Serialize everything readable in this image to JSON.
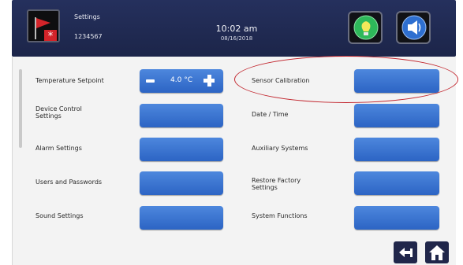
{
  "header": {
    "title": "Settings",
    "subtitle": "1234567",
    "time": "10:02 am",
    "date": "08/16/2018",
    "bg_color": "#1c2549",
    "icons": {
      "alarm": "alarm-flag-icon",
      "light": "lightbulb-icon",
      "sound": "speaker-icon"
    }
  },
  "menu": {
    "left": [
      {
        "label": "Temperature Setpoint"
      },
      {
        "label": "Device Control\nSettings"
      },
      {
        "label": "Alarm Settings"
      },
      {
        "label": "Users and Passwords"
      },
      {
        "label": "Sound Settings"
      }
    ],
    "right": [
      {
        "label": "Sensor Calibration"
      },
      {
        "label": "Date / Time"
      },
      {
        "label": "Auxiliary Systems"
      },
      {
        "label": "Restore Factory\nSettings"
      },
      {
        "label": "System Functions"
      }
    ]
  },
  "setpoint": {
    "value": "4.0 °C"
  },
  "annotation": {
    "highlighted_item": "Sensor Calibration",
    "color": "#c2262e"
  },
  "footer": {
    "icons": [
      "back-arrow-icon",
      "home-icon"
    ]
  },
  "colors": {
    "button_blue": "#3a74d2",
    "panel_bg": "#f3f3f3"
  }
}
